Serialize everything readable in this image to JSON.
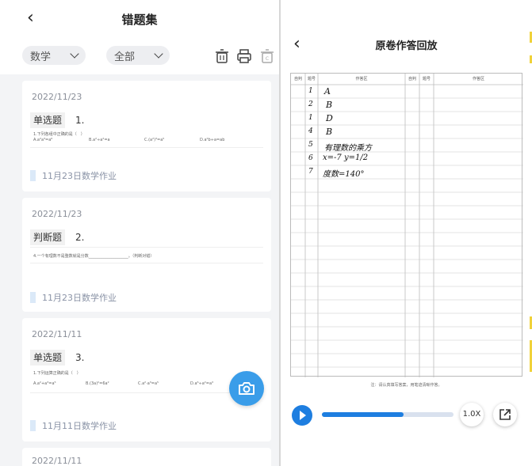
{
  "left": {
    "title": "错题集",
    "filters": {
      "subject": "数学",
      "scope": "全部"
    },
    "cards": [
      {
        "date": "2022/11/23",
        "type": "单选题",
        "num": "1.",
        "question": "1.下列各组中正确的是（　）",
        "options": [
          "A.a²a³=a⁶",
          "B.a²÷a²=a",
          "C.(a²)³=a⁵",
          "D.a²b÷a=ab"
        ],
        "homework": "11月23日数学作业"
      },
      {
        "date": "2022/11/23",
        "type": "判断题",
        "num": "2.",
        "question": "4.一个有理数不是整数就是分数____________________。（判断对错）",
        "homework": "11月23日数学作业"
      },
      {
        "date": "2022/11/11",
        "type": "单选题",
        "num": "3.",
        "question": "1.下列运算正确的是（　）",
        "options": [
          "A.a²+a³=a⁵",
          "B.(3a)²=6a²",
          "C.a²·a³=a⁵",
          "D.a⁶÷a²=a³"
        ],
        "homework": "11月11日数学作业"
      },
      {
        "date": "2022/11/11"
      }
    ]
  },
  "right": {
    "title": "原卷作答回放",
    "headers": [
      "自判",
      "题号",
      "作答区",
      "自判",
      "题号",
      "作答区"
    ],
    "handwriting": [
      {
        "num": "1",
        "answer": "A"
      },
      {
        "num": "2",
        "answer": "B"
      },
      {
        "num": "1",
        "answer": "D"
      },
      {
        "num": "4",
        "answer": "B"
      },
      {
        "num": "5",
        "answer": "有理数的乘方"
      },
      {
        "num": "6",
        "answer": "x=-7  y=1/2"
      },
      {
        "num": "7",
        "answer": "度数=140°"
      }
    ],
    "note": "注：请认真填写答案，用笔迹清晰作答。",
    "player": {
      "progress": 0.62,
      "speed": "1.0X"
    }
  },
  "colors": {
    "accent": "#3a9de9",
    "player": "#1e7ee0"
  }
}
